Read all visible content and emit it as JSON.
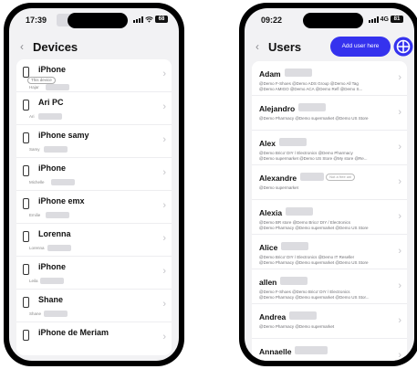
{
  "left_phone": {
    "status": {
      "time": "17:39",
      "battery": "68"
    },
    "title": "Devices",
    "devices": [
      {
        "name": "iPhone",
        "badge": "This device",
        "owner": "Hajar"
      },
      {
        "name": "Ari PC",
        "owner": "Ari"
      },
      {
        "name": "iPhone samy",
        "owner": "Samy"
      },
      {
        "name": "iPhone",
        "owner": "Michelle"
      },
      {
        "name": "iPhone emx",
        "owner": "Emilie"
      },
      {
        "name": "Lorenna",
        "owner": "Lorenna"
      },
      {
        "name": "iPhone",
        "owner": "Leila"
      },
      {
        "name": "Shane",
        "owner": "Shane"
      },
      {
        "name": "iPhone de Meriam",
        "owner": ""
      }
    ]
  },
  "right_phone": {
    "status": {
      "time": "09:22",
      "network": "4G",
      "battery": "81"
    },
    "title": "Users",
    "add_user_label": "Add user here",
    "users": [
      {
        "name": "Adam",
        "groups": "@Demo F-Shoes @Demo ADS Group @Demo All Tag",
        "groups2": "@Demo AMIGO @Demo ACA @Demo Refl @Demo S..."
      },
      {
        "name": "Alejandro",
        "groups": "@Demo Pharmacy @Demo supermarket @Demo US Store"
      },
      {
        "name": "Alex",
        "groups": "@Demo Brico' DIY / Electronics @Demo Pharmacy",
        "groups2": "@Demo supermarket @Demo US Store @My store @Re..."
      },
      {
        "name": "Alexandre",
        "tag": "Not a free uni",
        "groups": "@Demo supermarket"
      },
      {
        "name": "Alexia",
        "groups": "@Demo BR store @Demo Brico' DIY / Electronics",
        "groups2": "@Demo Pharmacy @Demo supermarket @Demo US Store"
      },
      {
        "name": "Alice",
        "groups": "@Demo Brico' DIY / Electronics @Demo IT Reseller",
        "groups2": "@Demo Pharmacy @Demo supermarket @Demo US Store"
      },
      {
        "name": "allen",
        "groups": "@Demo F-Shoes @Demo Brico' DIY / Electronics",
        "groups2": "@Demo Pharmacy @Demo supermarket @Demo US Stor..."
      },
      {
        "name": "Andrea",
        "groups": "@Demo Pharmacy @Demo supermarket"
      },
      {
        "name": "Annaelle",
        "groups": ""
      }
    ]
  },
  "colors": {
    "accent": "#3532ee"
  }
}
